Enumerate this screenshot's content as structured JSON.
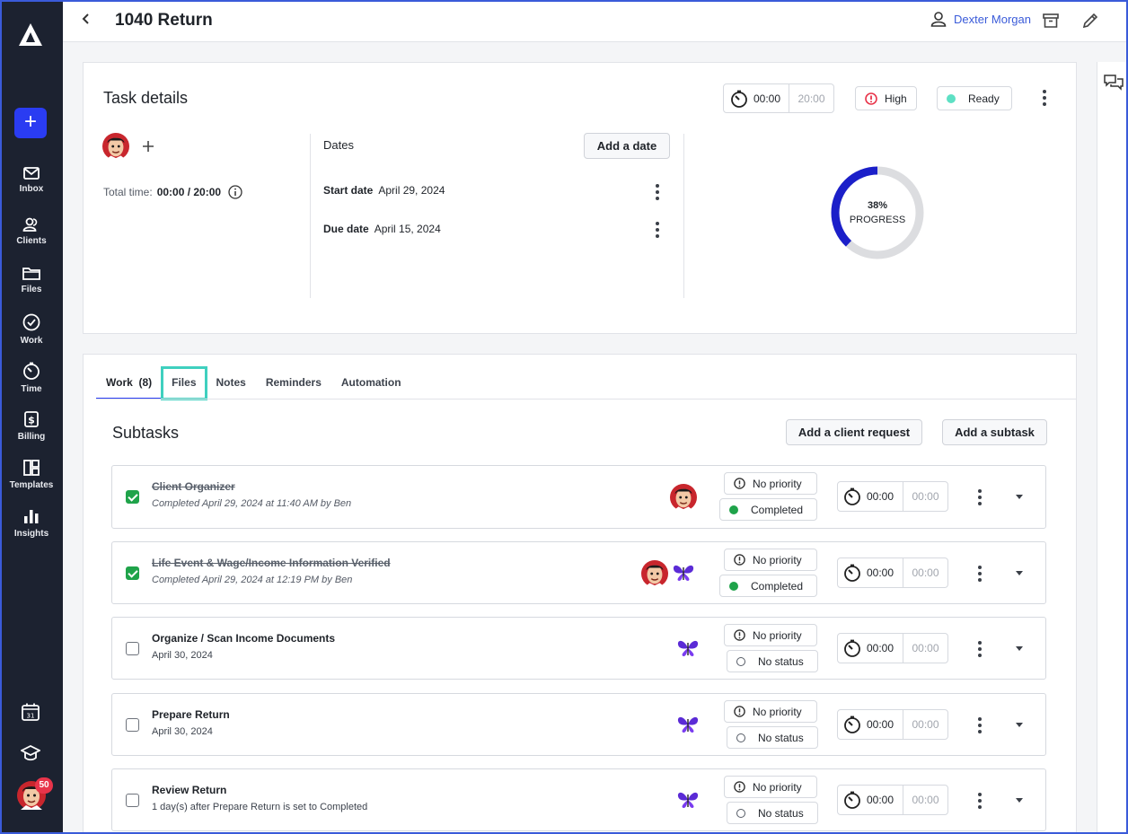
{
  "sidebar": {
    "nav": [
      {
        "label": "Inbox",
        "icon": "mail-icon"
      },
      {
        "label": "Clients",
        "icon": "users-icon"
      },
      {
        "label": "Files",
        "icon": "folder-icon"
      },
      {
        "label": "Work",
        "icon": "check-circle-icon"
      },
      {
        "label": "Time",
        "icon": "stopwatch-icon"
      },
      {
        "label": "Billing",
        "icon": "dollar-icon"
      },
      {
        "label": "Templates",
        "icon": "templates-icon"
      },
      {
        "label": "Insights",
        "icon": "bar-chart-icon"
      }
    ],
    "calendar_day": "31",
    "notifications": "50"
  },
  "header": {
    "title": "1040 Return",
    "user": "Dexter Morgan"
  },
  "task": {
    "section_title": "Task details",
    "timer_elapsed": "00:00",
    "timer_budget": "20:00",
    "priority": "High",
    "status": "Ready",
    "total_time_label": "Total time:",
    "total_time_value": "00:00 / 20:00",
    "dates_label": "Dates",
    "add_date": "Add a date",
    "start_date_label": "Start date",
    "start_date": "April 29, 2024",
    "due_date_label": "Due date",
    "due_date": "April 15, 2024",
    "progress_percent": "38%",
    "progress_value": 0.38,
    "progress_label": "PROGRESS"
  },
  "tabs": {
    "work": "Work",
    "work_count": "(8)",
    "files": "Files",
    "notes": "Notes",
    "reminders": "Reminders",
    "automation": "Automation"
  },
  "subtasks": {
    "title": "Subtasks",
    "add_client_request": "Add a client request",
    "add_subtask": "Add a subtask",
    "rows": [
      {
        "title": "Client Organizer",
        "sub": "Completed April 29, 2024 at 11:40 AM by Ben",
        "priority": "No priority",
        "status": "Completed",
        "t1": "00:00",
        "t2": "00:00"
      },
      {
        "title": "Life Event & Wage/Income Information Verified",
        "sub": "Completed April 29, 2024 at 12:19 PM by Ben",
        "priority": "No priority",
        "status": "Completed",
        "t1": "00:00",
        "t2": "00:00"
      },
      {
        "title": "Organize / Scan Income Documents",
        "sub": "April 30, 2024",
        "priority": "No priority",
        "status": "No status",
        "t1": "00:00",
        "t2": "00:00"
      },
      {
        "title": "Prepare Return",
        "sub": "April 30, 2024",
        "priority": "No priority",
        "status": "No status",
        "t1": "00:00",
        "t2": "00:00"
      },
      {
        "title": "Review Return",
        "sub": "1 day(s) after Prepare Return is set to Completed",
        "priority": "No priority",
        "status": "No status",
        "t1": "00:00",
        "t2": "00:00"
      }
    ]
  },
  "colors": {
    "accent": "#2a3cf2",
    "sidebar": "#1c2230",
    "link": "#3a5bd9",
    "completed": "#1fa34a",
    "ready": "#5ee0c4",
    "high": "#e8344a"
  }
}
